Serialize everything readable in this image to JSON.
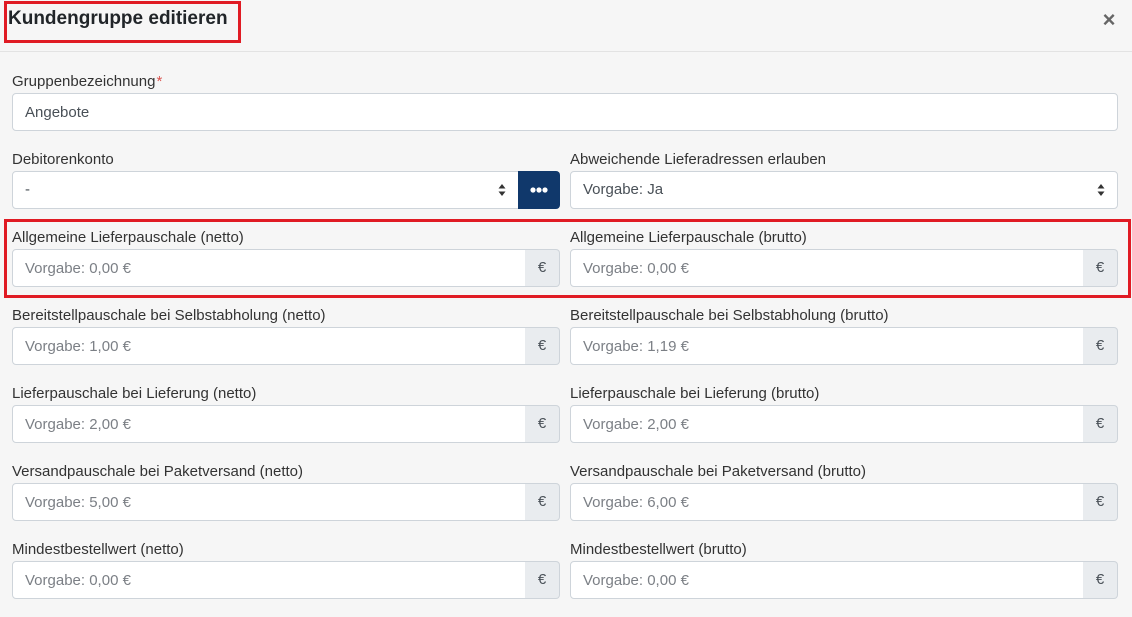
{
  "modal": {
    "title": "Kundengruppe editieren",
    "close_label": "×"
  },
  "group_name": {
    "label": "Gruppenbezeichnung",
    "required_mark": "*",
    "value": "Angebote"
  },
  "debitor": {
    "label": "Debitorenkonto",
    "selected": "-"
  },
  "alt_delivery": {
    "label": "Abweichende Lieferadressen erlauben",
    "selected": "Vorgabe: Ja"
  },
  "currency_symbol": "€",
  "fields": [
    {
      "netto_label": "Allgemeine Lieferpauschale (netto)",
      "netto_placeholder": "Vorgabe: 0,00 €",
      "brutto_label": "Allgemeine Lieferpauschale (brutto)",
      "brutto_placeholder": "Vorgabe: 0,00 €"
    },
    {
      "netto_label": "Bereitstellpauschale bei Selbstabholung (netto)",
      "netto_placeholder": "Vorgabe: 1,00 €",
      "brutto_label": "Bereitstellpauschale bei Selbstabholung (brutto)",
      "brutto_placeholder": "Vorgabe: 1,19 €"
    },
    {
      "netto_label": "Lieferpauschale bei Lieferung (netto)",
      "netto_placeholder": "Vorgabe: 2,00 €",
      "brutto_label": "Lieferpauschale bei Lieferung (brutto)",
      "brutto_placeholder": "Vorgabe: 2,00 €"
    },
    {
      "netto_label": "Versandpauschale bei Paketversand (netto)",
      "netto_placeholder": "Vorgabe: 5,00 €",
      "brutto_label": "Versandpauschale bei Paketversand (brutto)",
      "brutto_placeholder": "Vorgabe: 6,00 €"
    },
    {
      "netto_label": "Mindestbestellwert (netto)",
      "netto_placeholder": "Vorgabe: 0,00 €",
      "brutto_label": "Mindestbestellwert (brutto)",
      "brutto_placeholder": "Vorgabe: 0,00 €"
    }
  ],
  "colors": {
    "highlight": "#e01b24",
    "dots_button": "#10386b",
    "addon_bg": "#e9ecef"
  },
  "icons": {
    "close": "close-icon",
    "select_arrows": "select-arrows-icon",
    "dots": "dots-icon"
  }
}
